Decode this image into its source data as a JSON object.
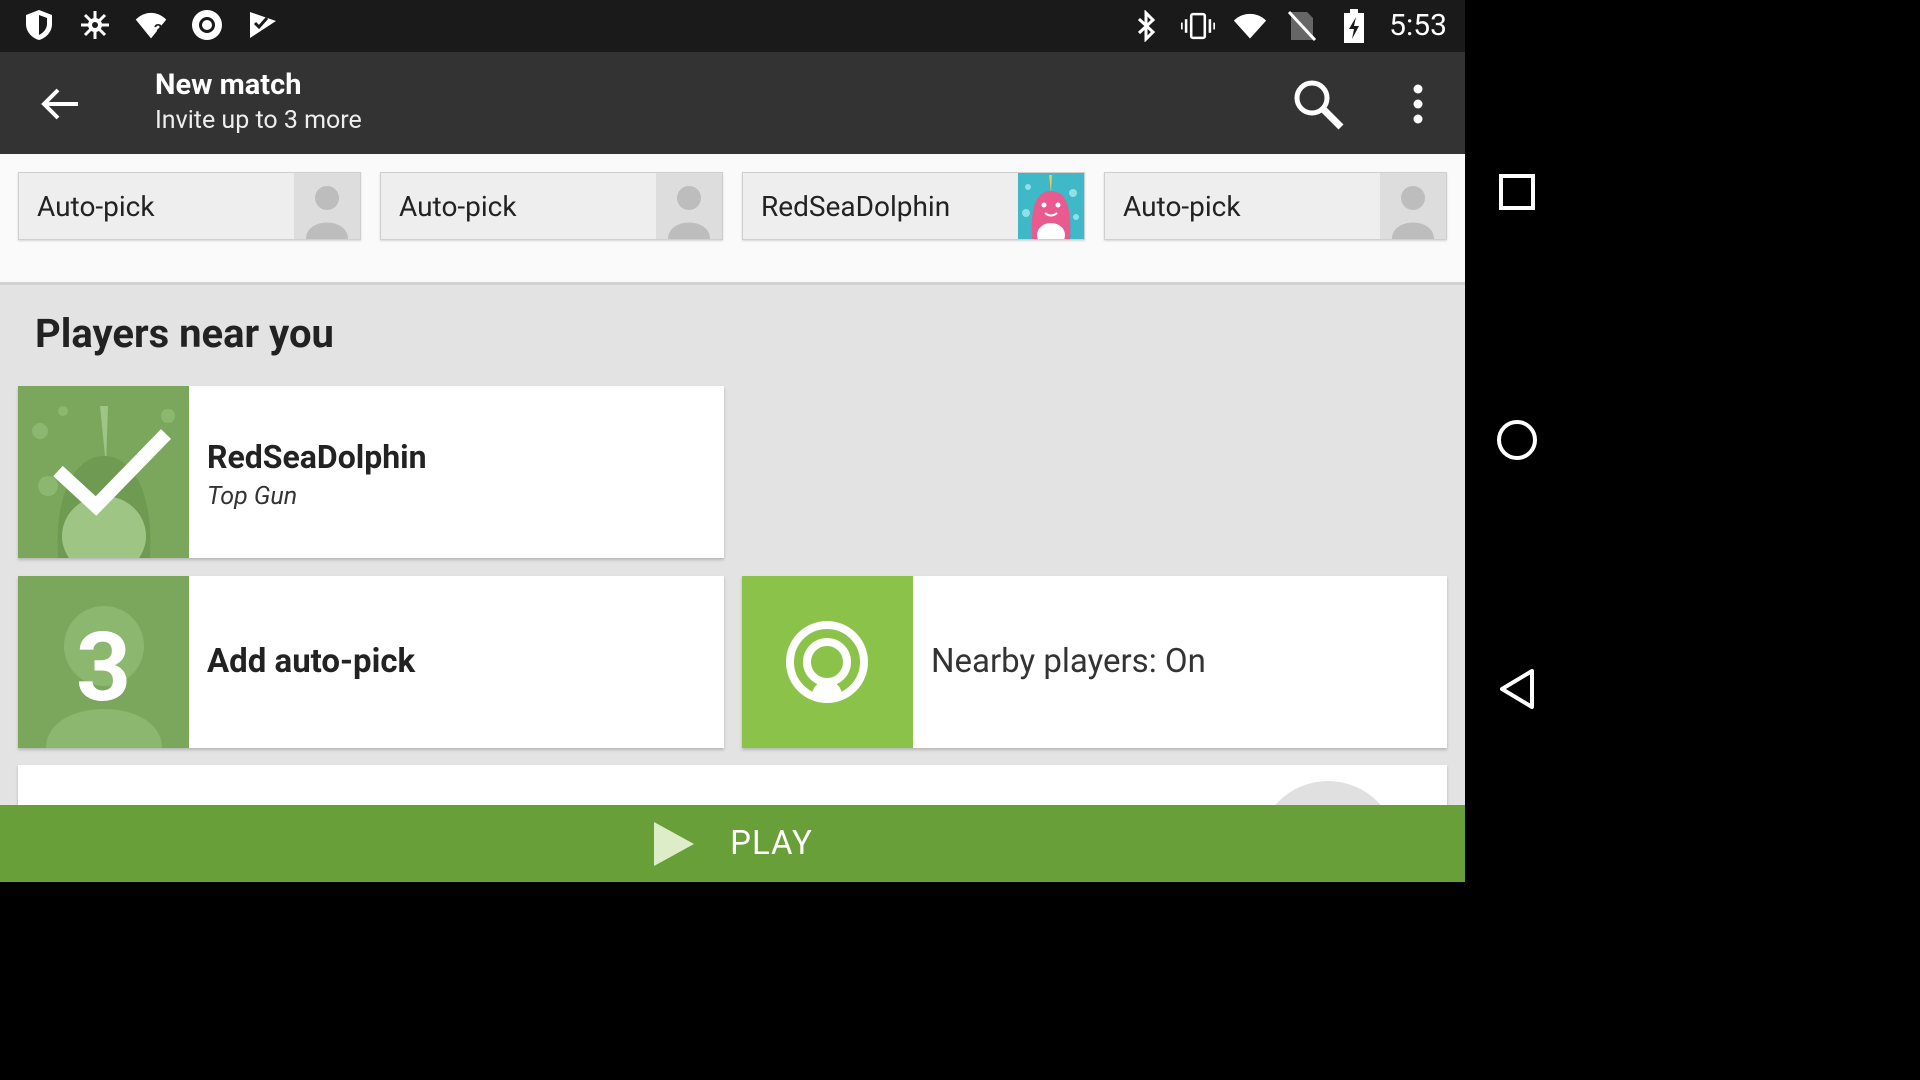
{
  "status_bar": {
    "time": "5:53",
    "left_icons": [
      "shield-icon",
      "settings-sparkle-icon",
      "wifi-question-icon",
      "record-circle-icon",
      "checkmark-flag-icon"
    ],
    "right_icons": [
      "bluetooth-icon",
      "vibrate-icon",
      "wifi-icon",
      "no-sim-icon",
      "battery-charging-icon"
    ]
  },
  "action_bar": {
    "title": "New match",
    "subtitle": "Invite up to 3 more"
  },
  "slots": [
    {
      "label": "Auto-pick",
      "avatar": "person-placeholder"
    },
    {
      "label": "Auto-pick",
      "avatar": "person-placeholder"
    },
    {
      "label": "RedSeaDolphin",
      "avatar": "unicorn-avatar"
    },
    {
      "label": "Auto-pick",
      "avatar": "person-placeholder"
    }
  ],
  "section_title": "Players near you",
  "cards": {
    "player": {
      "name": "RedSeaDolphin",
      "subtitle": "Top Gun",
      "selected": true
    },
    "auto_pick": {
      "count": "3",
      "label": "Add auto-pick"
    },
    "nearby": {
      "label": "Nearby players: On",
      "accent": "#8bc34a"
    }
  },
  "play_button": {
    "label": "PLAY",
    "color": "#689f38"
  },
  "nav": [
    "recents-icon",
    "home-icon",
    "back-icon"
  ]
}
